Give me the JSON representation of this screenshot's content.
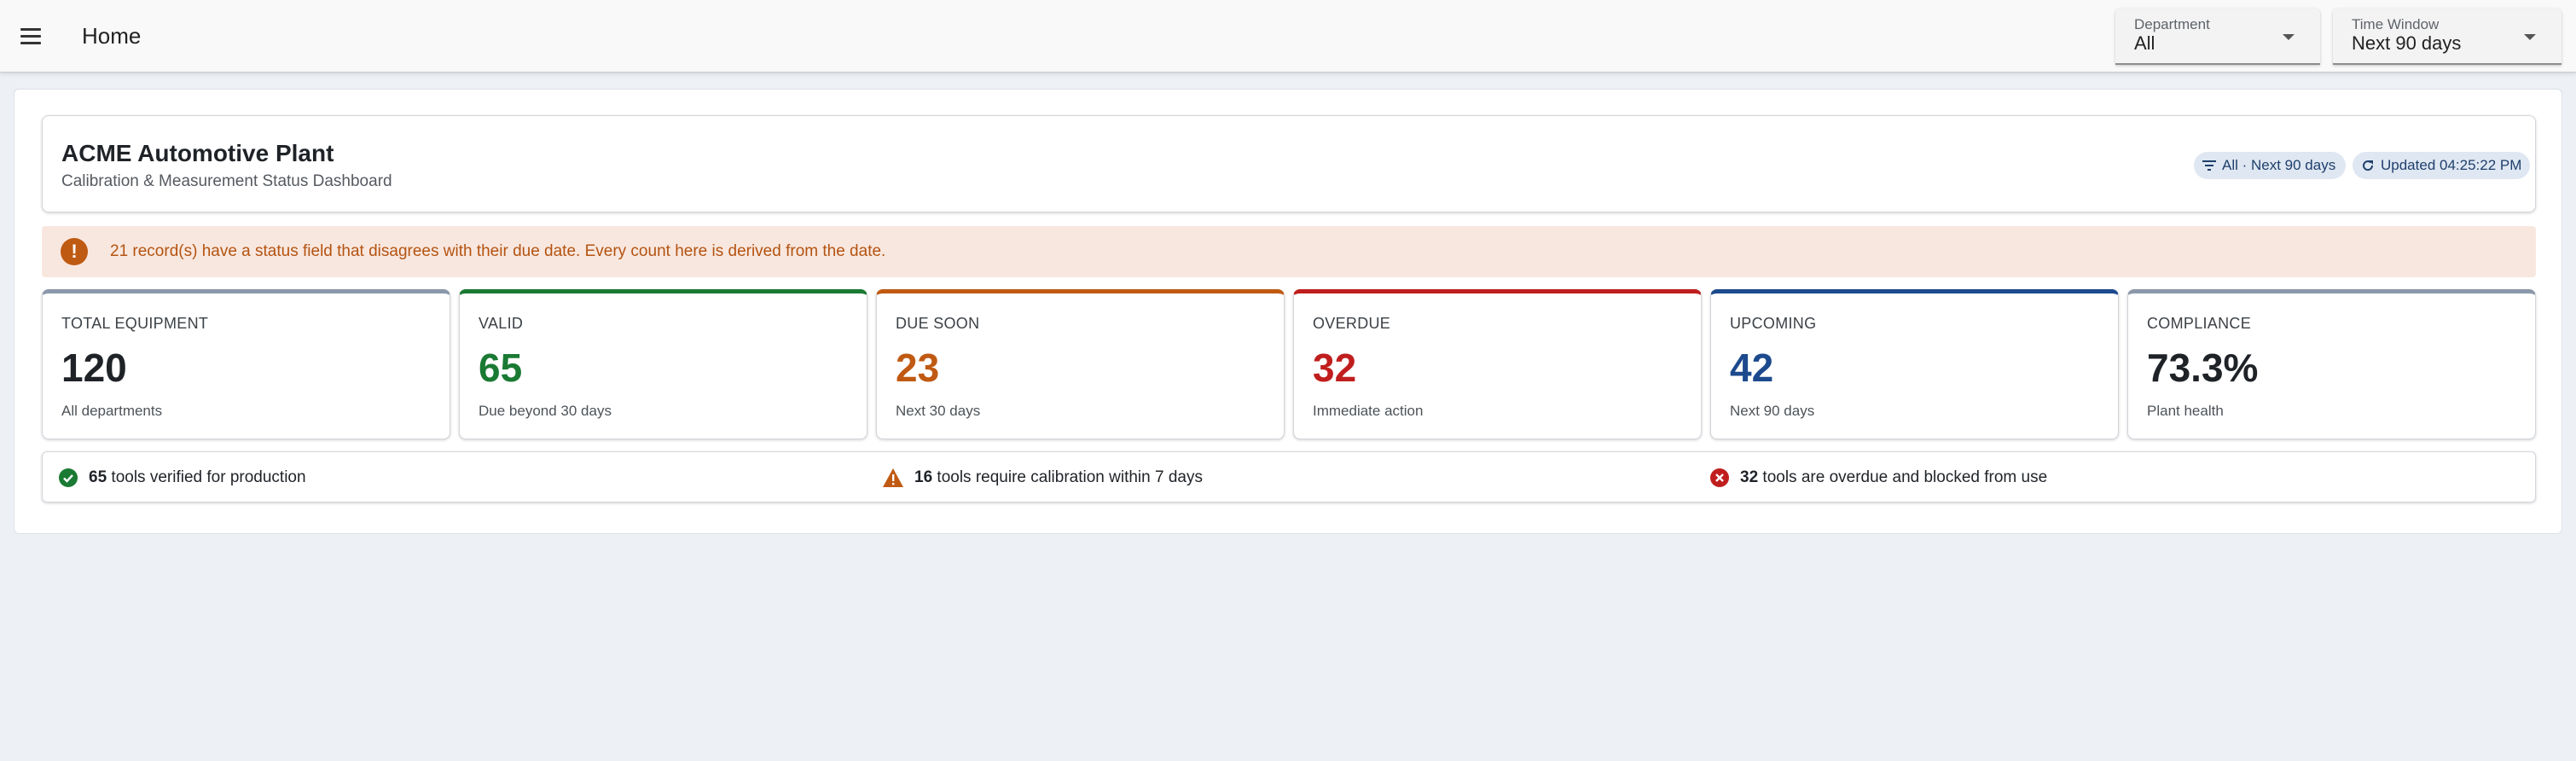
{
  "appbar": {
    "title": "Home",
    "department": {
      "label": "Department",
      "value": "All"
    },
    "time_window": {
      "label": "Time Window",
      "value": "Next 90 days"
    }
  },
  "header": {
    "title": "ACME Automotive Plant",
    "subtitle": "Calibration & Measurement Status Dashboard",
    "filter_chip": "All · Next 90 days",
    "updated_chip": "Updated 04:25:22 PM"
  },
  "banner": {
    "text": "21 record(s) have a status field that disagrees with their due date. Every count here is derived from the date.",
    "icon_glyph": "!"
  },
  "kpis": [
    {
      "label": "TOTAL EQUIPMENT",
      "value": "120",
      "sub": "All departments"
    },
    {
      "label": "VALID",
      "value": "65",
      "sub": "Due beyond 30 days"
    },
    {
      "label": "DUE SOON",
      "value": "23",
      "sub": "Next 30 days"
    },
    {
      "label": "OVERDUE",
      "value": "32",
      "sub": "Immediate action"
    },
    {
      "label": "UPCOMING",
      "value": "42",
      "sub": "Next 90 days"
    },
    {
      "label": "COMPLIANCE",
      "value": "73.3%",
      "sub": "Plant health"
    }
  ],
  "summary": [
    {
      "count": "65",
      "text": "tools verified for production",
      "icon": "check-circle-icon"
    },
    {
      "count": "16",
      "text": "tools require calibration within 7 days",
      "icon": "warning-triangle-icon"
    },
    {
      "count": "32",
      "text": "tools are overdue and blocked from use",
      "icon": "error-circle-icon"
    }
  ],
  "colors": {
    "valid": "#1a7a33",
    "due_soon": "#c05a12",
    "overdue": "#c01e1e",
    "upcoming": "#1d4a8e",
    "neutral": "#8b98aa",
    "warning_bg": "#f8e7df"
  }
}
